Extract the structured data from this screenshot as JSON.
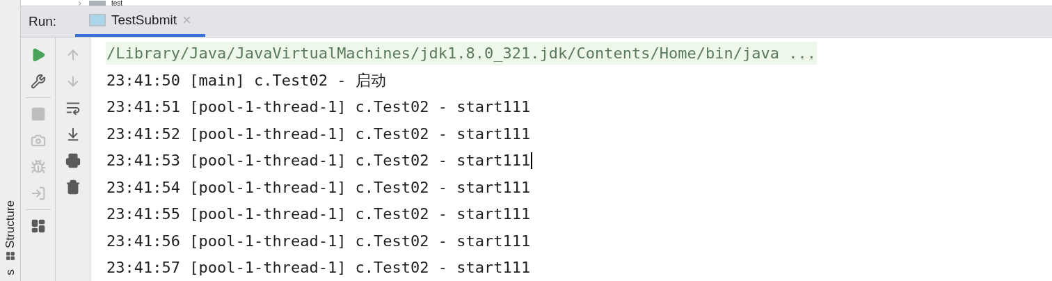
{
  "project_tree": {
    "item": "test"
  },
  "run_panel": {
    "label": "Run:",
    "tabs": [
      {
        "label": "TestSubmit",
        "selected": true,
        "close": "×"
      }
    ]
  },
  "toolbar_left": [
    {
      "kind": "run",
      "disabled": false
    },
    {
      "kind": "settings",
      "disabled": false
    },
    {
      "kind": "separator"
    },
    {
      "kind": "stop",
      "disabled": true
    },
    {
      "kind": "camera",
      "disabled": true
    },
    {
      "kind": "bug",
      "disabled": true
    },
    {
      "kind": "login",
      "disabled": true
    },
    {
      "kind": "separator"
    },
    {
      "kind": "layout",
      "disabled": false
    }
  ],
  "toolbar_right": [
    {
      "kind": "up",
      "disabled": true
    },
    {
      "kind": "down",
      "disabled": true
    },
    {
      "kind": "wrap",
      "disabled": false
    },
    {
      "kind": "scroll",
      "disabled": false
    },
    {
      "kind": "print",
      "disabled": false
    },
    {
      "kind": "delete",
      "disabled": false
    }
  ],
  "side_tab": {
    "label": "Structure",
    "cut_label": "s"
  },
  "console": [
    {
      "text": "/Library/Java/JavaVirtualMachines/jdk1.8.0_321.jdk/Contents/Home/bin/java ...",
      "kind": "command",
      "caret": false
    },
    {
      "text": "23:41:50 [main] c.Test02 - 启动",
      "kind": "output",
      "caret": false
    },
    {
      "text": "23:41:51 [pool-1-thread-1] c.Test02 - start111",
      "kind": "output",
      "caret": false
    },
    {
      "text": "23:41:52 [pool-1-thread-1] c.Test02 - start111",
      "kind": "output",
      "caret": false
    },
    {
      "text": "23:41:53 [pool-1-thread-1] c.Test02 - start111",
      "kind": "output",
      "caret": true
    },
    {
      "text": "23:41:54 [pool-1-thread-1] c.Test02 - start111",
      "kind": "output",
      "caret": false
    },
    {
      "text": "23:41:55 [pool-1-thread-1] c.Test02 - start111",
      "kind": "output",
      "caret": false
    },
    {
      "text": "23:41:56 [pool-1-thread-1] c.Test02 - start111",
      "kind": "output",
      "caret": false
    },
    {
      "text": "23:41:57 [pool-1-thread-1] c.Test02 - start111",
      "kind": "output",
      "caret": false
    }
  ]
}
